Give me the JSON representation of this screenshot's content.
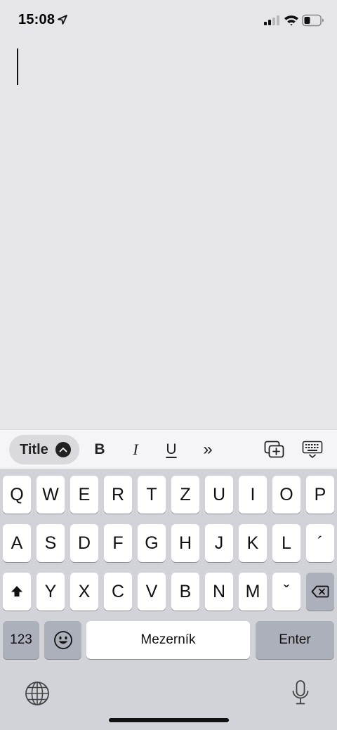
{
  "status_bar": {
    "time": "15:08",
    "icons": [
      "location-arrow-icon",
      "cellular-signal-icon",
      "wifi-icon",
      "battery-icon"
    ]
  },
  "editor": {
    "content": ""
  },
  "format_toolbar": {
    "style_label": "Title",
    "bold_label": "B",
    "italic_label": "I",
    "underline_label": "U",
    "more_label": "»",
    "icons": [
      "chevron-up-icon",
      "insert-media-icon",
      "dismiss-keyboard-icon"
    ]
  },
  "keyboard": {
    "row1": [
      "Q",
      "W",
      "E",
      "R",
      "T",
      "Z",
      "U",
      "I",
      "O",
      "P"
    ],
    "row2": [
      "A",
      "S",
      "D",
      "F",
      "G",
      "H",
      "J",
      "K",
      "L",
      "´"
    ],
    "row3": [
      "Y",
      "X",
      "C",
      "V",
      "B",
      "N",
      "M",
      "ˇ"
    ],
    "numbers_label": "123",
    "space_label": "Mezerník",
    "return_label": "Enter",
    "icons": [
      "shift-icon",
      "backspace-icon",
      "emoji-icon",
      "globe-icon",
      "microphone-icon"
    ]
  },
  "colors": {
    "background": "#e6e5ea",
    "keyboard_bg": "#d1d3d9",
    "key_light": "#ffffff",
    "key_dark": "#abb0bb"
  }
}
